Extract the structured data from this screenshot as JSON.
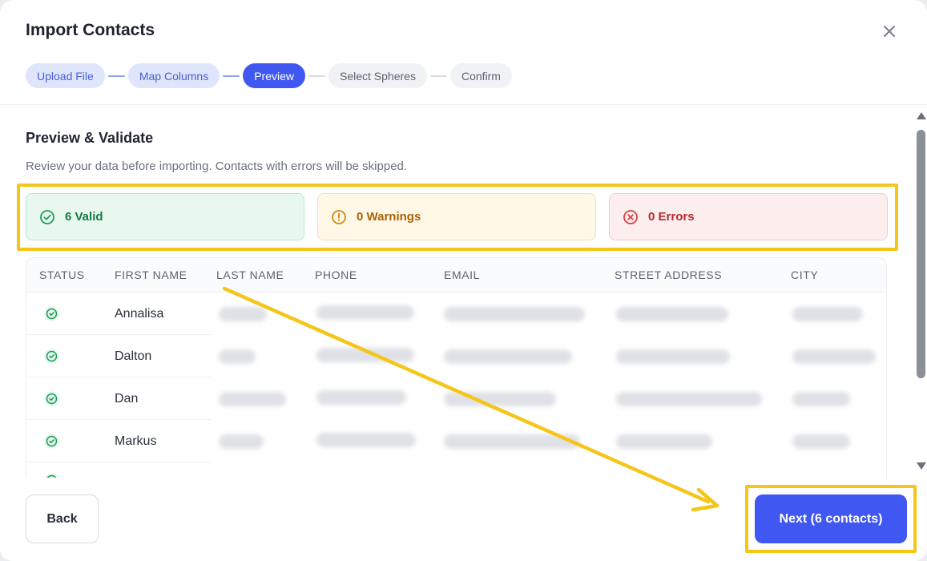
{
  "modal": {
    "title": "Import Contacts",
    "close_icon": "close-icon"
  },
  "steps": [
    {
      "label": "Upload File",
      "state": "done"
    },
    {
      "label": "Map Columns",
      "state": "done"
    },
    {
      "label": "Preview",
      "state": "active"
    },
    {
      "label": "Select Spheres",
      "state": "todo"
    },
    {
      "label": "Confirm",
      "state": "todo"
    }
  ],
  "preview": {
    "title": "Preview & Validate",
    "description": "Review your data before importing. Contacts with errors will be skipped."
  },
  "summary": {
    "valid": "6 Valid",
    "warnings": "0 Warnings",
    "errors": "0 Errors"
  },
  "table": {
    "columns": [
      "STATUS",
      "FIRST NAME",
      "LAST NAME",
      "PHONE",
      "EMAIL",
      "STREET ADDRESS",
      "CITY"
    ],
    "rows": [
      {
        "status": "valid",
        "first_name": "Annalisa"
      },
      {
        "status": "valid",
        "first_name": "Dalton"
      },
      {
        "status": "valid",
        "first_name": "Dan"
      },
      {
        "status": "valid",
        "first_name": "Markus"
      }
    ]
  },
  "footer": {
    "back_label": "Back",
    "next_label": "Next (6 contacts)"
  },
  "colors": {
    "accent": "#4057f2",
    "valid": "#157a45",
    "warning": "#a86208",
    "error": "#b4292e",
    "highlight": "#f5c518"
  }
}
